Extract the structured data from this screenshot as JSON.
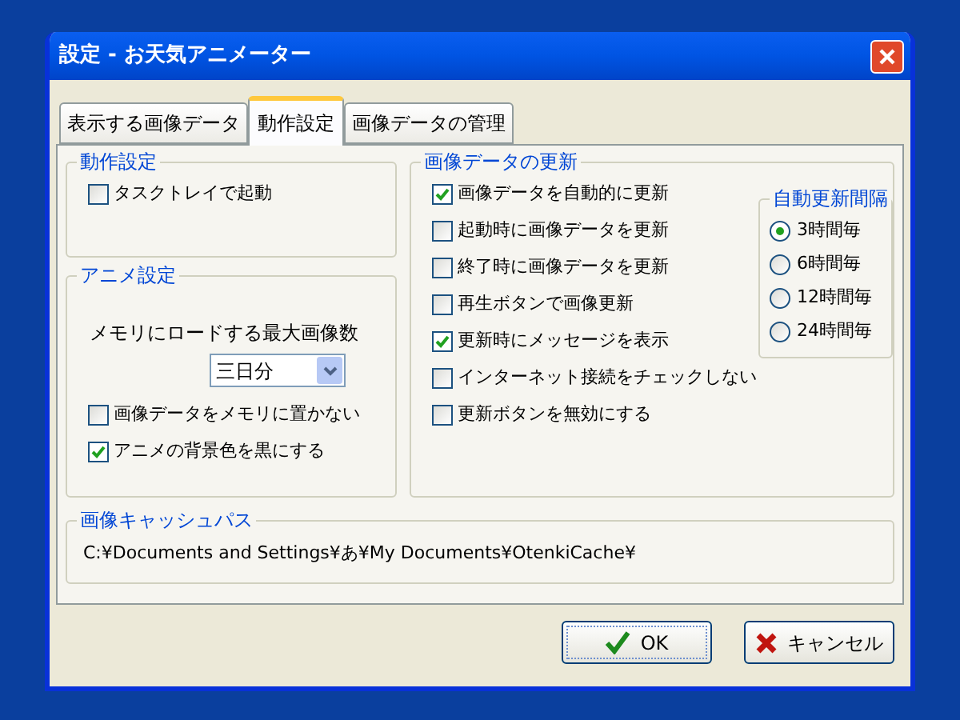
{
  "window": {
    "title": "設定 - お天気アニメーター"
  },
  "tabs": [
    {
      "label": "表示する画像データ",
      "selected": false
    },
    {
      "label": "動作設定",
      "selected": true
    },
    {
      "label": "画像データの管理",
      "selected": false
    }
  ],
  "startup_group": {
    "title": "動作設定",
    "options": [
      {
        "label": "タスクトレイで起動",
        "checked": false
      }
    ]
  },
  "anime_group": {
    "title": "アニメ設定",
    "max_images_label": "メモリにロードする最大画像数",
    "max_images_value": "三日分",
    "options": [
      {
        "label": "画像データをメモリに置かない",
        "checked": false
      },
      {
        "label": "アニメの背景色を黒にする",
        "checked": true
      }
    ]
  },
  "update_group": {
    "title": "画像データの更新",
    "options": [
      {
        "label": "画像データを自動的に更新",
        "checked": true
      },
      {
        "label": "起動時に画像データを更新",
        "checked": false
      },
      {
        "label": "終了時に画像データを更新",
        "checked": false
      },
      {
        "label": "再生ボタンで画像更新",
        "checked": false
      },
      {
        "label": "更新時にメッセージを表示",
        "checked": true
      },
      {
        "label": "インターネット接続をチェックしない",
        "checked": false
      },
      {
        "label": "更新ボタンを無効にする",
        "checked": false
      }
    ],
    "interval": {
      "title": "自動更新間隔",
      "options": [
        {
          "label": "3時間毎",
          "selected": true
        },
        {
          "label": "6時間毎",
          "selected": false
        },
        {
          "label": "12時間毎",
          "selected": false
        },
        {
          "label": "24時間毎",
          "selected": false
        }
      ]
    }
  },
  "cache_group": {
    "title": "画像キャッシュパス",
    "path": "C:¥Documents and Settings¥あ¥My Documents¥OtenkiCache¥"
  },
  "buttons": [
    {
      "kind": "ok",
      "label": "OK"
    },
    {
      "kind": "cancel",
      "label": "キャンセル"
    }
  ]
}
